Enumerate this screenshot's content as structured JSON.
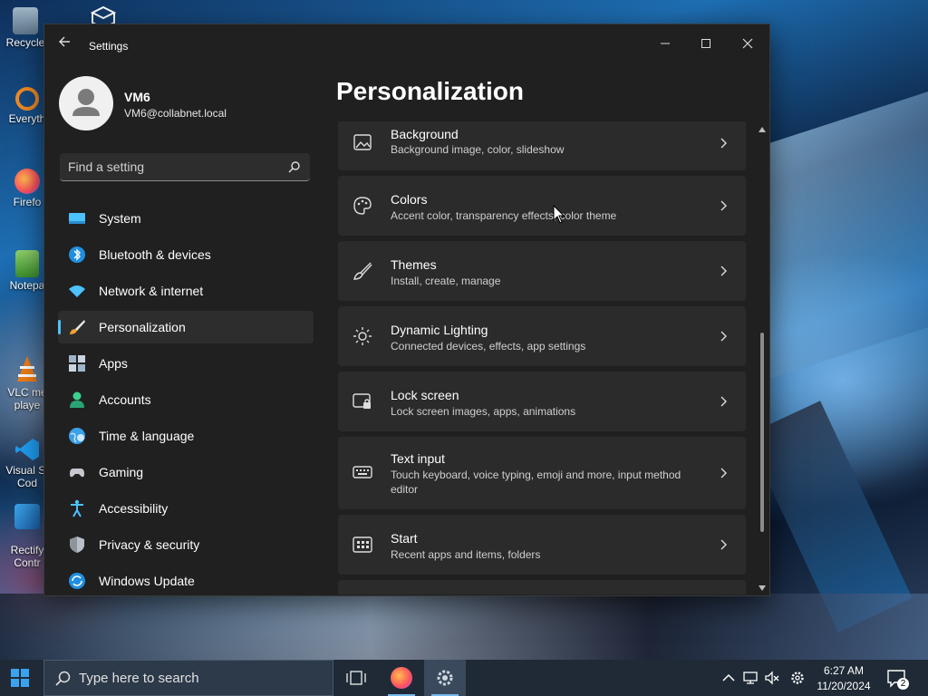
{
  "desktop": {
    "icons": [
      {
        "label": "Recycle"
      },
      {
        "label": "Everyth"
      },
      {
        "label": "Firefo"
      },
      {
        "label": "Notepa"
      },
      {
        "label": "VLC me\nplaye"
      },
      {
        "label": "Visual St\nCod"
      },
      {
        "label": "Rectify\nContr"
      }
    ]
  },
  "window": {
    "title": "Settings",
    "profile": {
      "name": "VM6",
      "email": "VM6@collabnet.local"
    },
    "search": {
      "placeholder": "Find a setting"
    },
    "nav": [
      {
        "label": "System",
        "icon": "system-icon",
        "active": false
      },
      {
        "label": "Bluetooth & devices",
        "icon": "bluetooth-icon",
        "active": false
      },
      {
        "label": "Network & internet",
        "icon": "wifi-icon",
        "active": false
      },
      {
        "label": "Personalization",
        "icon": "brush-icon",
        "active": true
      },
      {
        "label": "Apps",
        "icon": "apps-icon",
        "active": false
      },
      {
        "label": "Accounts",
        "icon": "accounts-icon",
        "active": false
      },
      {
        "label": "Time & language",
        "icon": "globe-icon",
        "active": false
      },
      {
        "label": "Gaming",
        "icon": "gamepad-icon",
        "active": false
      },
      {
        "label": "Accessibility",
        "icon": "accessibility-icon",
        "active": false
      },
      {
        "label": "Privacy & security",
        "icon": "shield-icon",
        "active": false
      },
      {
        "label": "Windows Update",
        "icon": "update-icon",
        "active": false
      }
    ],
    "page_title": "Personalization",
    "cards": [
      {
        "title": "Background",
        "subtitle": "Background image, color, slideshow",
        "icon": "image-icon"
      },
      {
        "title": "Colors",
        "subtitle": "Accent color, transparency effects, color theme",
        "icon": "palette-icon"
      },
      {
        "title": "Themes",
        "subtitle": "Install, create, manage",
        "icon": "brush-icon"
      },
      {
        "title": "Dynamic Lighting",
        "subtitle": "Connected devices, effects, app settings",
        "icon": "lighting-icon"
      },
      {
        "title": "Lock screen",
        "subtitle": "Lock screen images, apps, animations",
        "icon": "lock-screen-icon"
      },
      {
        "title": "Text input",
        "subtitle": "Touch keyboard, voice typing, emoji and more, input method editor",
        "icon": "keyboard-icon"
      },
      {
        "title": "Start",
        "subtitle": "Recent apps and items, folders",
        "icon": "start-icon"
      },
      {
        "title": "",
        "subtitle": "",
        "icon": ""
      }
    ]
  },
  "taskbar": {
    "search_placeholder": "Type here to search",
    "time": "6:27 AM",
    "date": "11/20/2024",
    "notification_count": "2"
  },
  "colors": {
    "accent": "#4cc2ff",
    "window_bg": "#202020",
    "card_bg": "#2b2b2b"
  }
}
